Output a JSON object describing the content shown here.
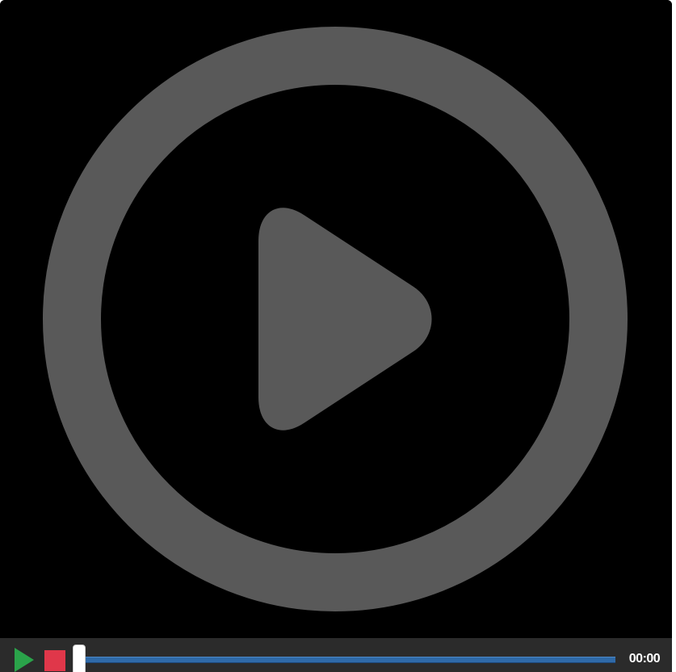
{
  "player": {
    "big_play_icon": "play-circle-icon",
    "controls": {
      "play_icon": "play-icon",
      "stop_icon": "stop-icon",
      "time": "00:00",
      "progress": 0
    },
    "colors": {
      "background": "#000000",
      "overlay_icon": "#595959",
      "control_bar": "#2b2b2b",
      "play_button": "#2aa34a",
      "stop_button": "#e0374a",
      "progress_track": "#2f6aa8",
      "time_text": "#ffffff"
    }
  }
}
